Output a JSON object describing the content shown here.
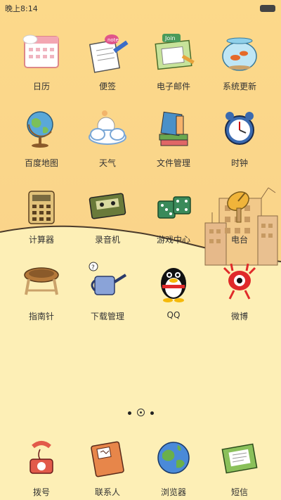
{
  "status": {
    "time": "晚上8:14"
  },
  "apps": [
    {
      "id": "calendar",
      "label": "日历"
    },
    {
      "id": "notes",
      "label": "便签"
    },
    {
      "id": "email",
      "label": "电子邮件"
    },
    {
      "id": "update",
      "label": "系统更新"
    },
    {
      "id": "maps",
      "label": "百度地图"
    },
    {
      "id": "weather",
      "label": "天气"
    },
    {
      "id": "files",
      "label": "文件管理"
    },
    {
      "id": "clock",
      "label": "时钟"
    },
    {
      "id": "calculator",
      "label": "计算器"
    },
    {
      "id": "recorder",
      "label": "录音机"
    },
    {
      "id": "games",
      "label": "游戏中心"
    },
    {
      "id": "radio",
      "label": "电台"
    },
    {
      "id": "compass",
      "label": "指南针"
    },
    {
      "id": "downloads",
      "label": "下载管理"
    },
    {
      "id": "qq",
      "label": "QQ"
    },
    {
      "id": "weibo",
      "label": "微博"
    }
  ],
  "dock": [
    {
      "id": "dialer",
      "label": "拨号"
    },
    {
      "id": "contacts",
      "label": "联系人"
    },
    {
      "id": "browser",
      "label": "浏览器"
    },
    {
      "id": "sms",
      "label": "短信"
    }
  ],
  "icon_text": {
    "notes_badge": "note",
    "email_badge": "Join"
  },
  "pager": {
    "pages": 3,
    "current": 2
  }
}
